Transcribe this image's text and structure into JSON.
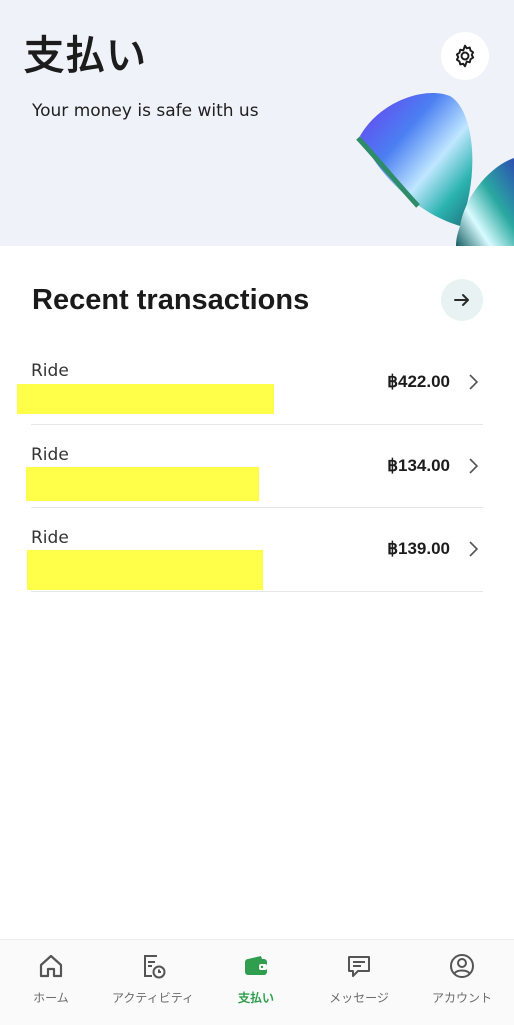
{
  "header": {
    "title": "支払い",
    "subtitle": "Your money is safe with us",
    "settings_icon": "gear-icon"
  },
  "recent": {
    "title": "Recent transactions",
    "arrow_icon": "arrow-right-icon",
    "items": [
      {
        "label": "Ride",
        "amount": "฿422.00"
      },
      {
        "label": "Ride",
        "amount": "฿134.00"
      },
      {
        "label": "Ride",
        "amount": "฿139.00"
      }
    ]
  },
  "nav": {
    "items": [
      {
        "label": "ホーム",
        "icon": "home-icon"
      },
      {
        "label": "アクティビティ",
        "icon": "activity-icon"
      },
      {
        "label": "支払い",
        "icon": "wallet-icon",
        "active": true
      },
      {
        "label": "メッセージ",
        "icon": "message-icon"
      },
      {
        "label": "アカウント",
        "icon": "account-icon"
      }
    ]
  },
  "colors": {
    "accent_green": "#2f9e4e",
    "hero_bg": "#eff2f8",
    "redaction": "#ffff4a"
  }
}
